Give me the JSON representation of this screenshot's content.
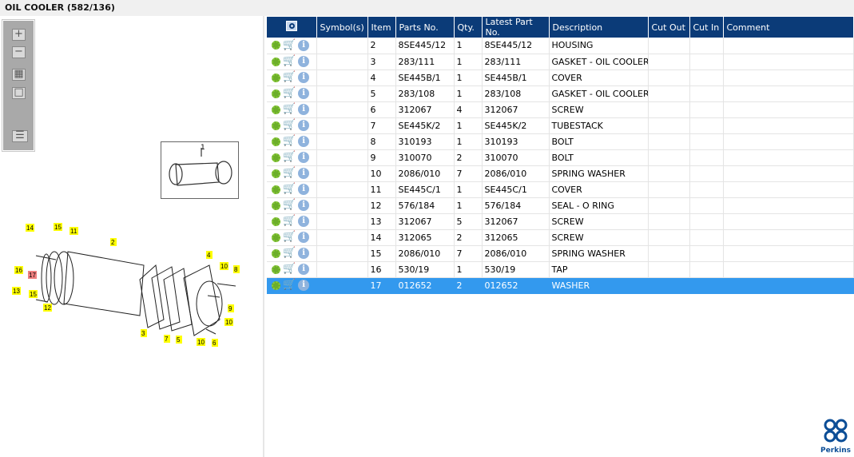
{
  "title": "OIL COOLER (582/136)",
  "toolbar": {
    "zoom_in": "+",
    "zoom_out": "−",
    "fit": "▦",
    "actual": "□",
    "panel": "☰"
  },
  "thumbnail": {
    "label": "1"
  },
  "diagram": {
    "callouts": [
      "14",
      "15",
      "11",
      "2",
      "16",
      "17",
      "13",
      "15",
      "12",
      "4",
      "10",
      "8",
      "9",
      "10",
      "3",
      "7",
      "5",
      "10",
      "6"
    ],
    "highlighted": "17",
    "highlight_color": "#f08080",
    "callout_color": "#ffff00"
  },
  "table": {
    "headers": [
      "",
      "Symbol(s)",
      "Item",
      "Parts No.",
      "Qty.",
      "Latest Part No.",
      "Description",
      "Cut Out",
      "Cut In",
      "Comment"
    ],
    "rows": [
      {
        "item": "2",
        "part": "8SE445/12",
        "qty": "1",
        "latest": "8SE445/12",
        "desc": "HOUSING"
      },
      {
        "item": "3",
        "part": "283/111",
        "qty": "1",
        "latest": "283/111",
        "desc": "GASKET - OIL COOLER"
      },
      {
        "item": "4",
        "part": "SE445B/1",
        "qty": "1",
        "latest": "SE445B/1",
        "desc": "COVER"
      },
      {
        "item": "5",
        "part": "283/108",
        "qty": "1",
        "latest": "283/108",
        "desc": "GASKET - OIL COOLER"
      },
      {
        "item": "6",
        "part": "312067",
        "qty": "4",
        "latest": "312067",
        "desc": "SCREW"
      },
      {
        "item": "7",
        "part": "SE445K/2",
        "qty": "1",
        "latest": "SE445K/2",
        "desc": "TUBESTACK"
      },
      {
        "item": "8",
        "part": "310193",
        "qty": "1",
        "latest": "310193",
        "desc": "BOLT"
      },
      {
        "item": "9",
        "part": "310070",
        "qty": "2",
        "latest": "310070",
        "desc": "BOLT"
      },
      {
        "item": "10",
        "part": "2086/010",
        "qty": "7",
        "latest": "2086/010",
        "desc": "SPRING WASHER"
      },
      {
        "item": "11",
        "part": "SE445C/1",
        "qty": "1",
        "latest": "SE445C/1",
        "desc": "COVER"
      },
      {
        "item": "12",
        "part": "576/184",
        "qty": "1",
        "latest": "576/184",
        "desc": "SEAL - O RING"
      },
      {
        "item": "13",
        "part": "312067",
        "qty": "5",
        "latest": "312067",
        "desc": "SCREW"
      },
      {
        "item": "14",
        "part": "312065",
        "qty": "2",
        "latest": "312065",
        "desc": "SCREW"
      },
      {
        "item": "15",
        "part": "2086/010",
        "qty": "7",
        "latest": "2086/010",
        "desc": "SPRING WASHER"
      },
      {
        "item": "16",
        "part": "530/19",
        "qty": "1",
        "latest": "530/19",
        "desc": "TAP"
      },
      {
        "item": "17",
        "part": "012652",
        "qty": "2",
        "latest": "012652",
        "desc": "WASHER",
        "selected": true
      }
    ]
  },
  "logo": {
    "text": "Perkins"
  },
  "colors": {
    "header": "#0b3b78",
    "selected": "#3399ee"
  }
}
